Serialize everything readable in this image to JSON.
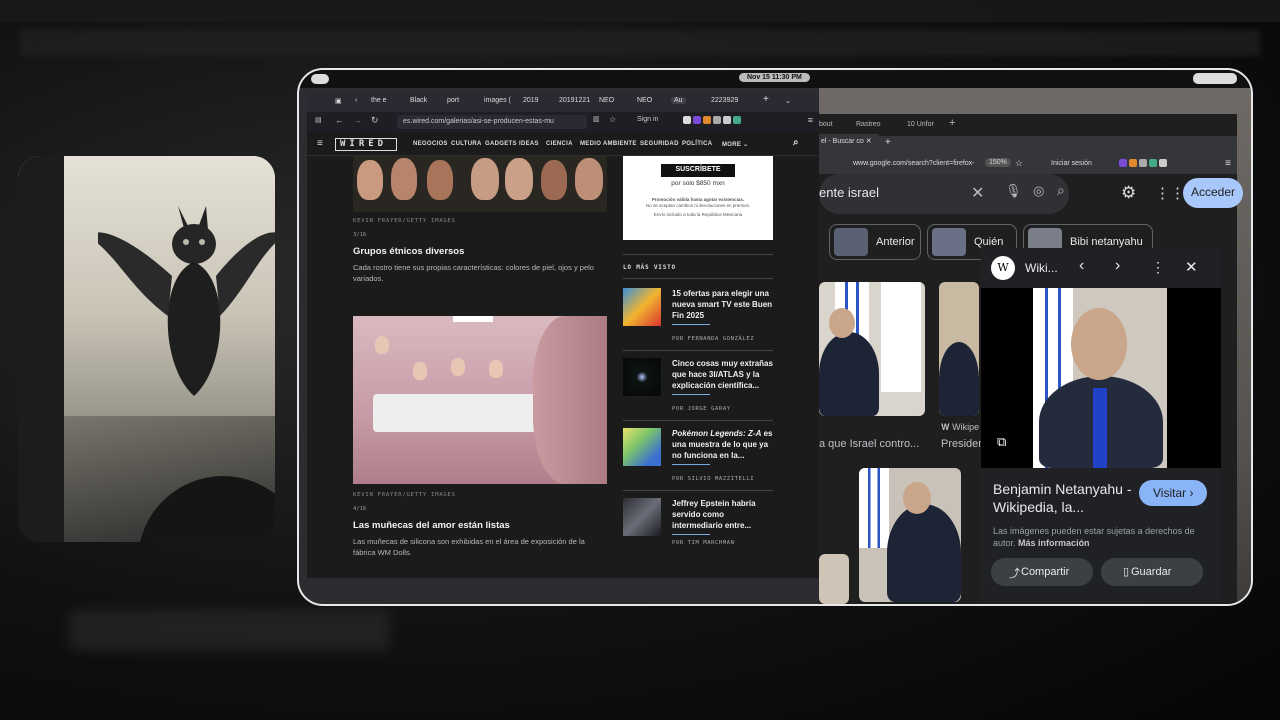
{
  "system": {
    "clock": "Nov 15  11:30 PM"
  },
  "wired_browser": {
    "tabs": [
      "the e",
      "Black",
      "port",
      "images (",
      "2019",
      "20191221",
      "NEO",
      "NEO",
      "Au",
      "2223929"
    ],
    "url": "es.wired.com/galerias/asi-se-producen-estas-mu",
    "sign_in": "Sign in",
    "logo": "WIRED",
    "nav": [
      "NEGOCIOS",
      "CULTURA",
      "GADGETS",
      "IDEAS",
      "CIENCIA",
      "MEDIO AMBIENTE",
      "SEGURIDAD",
      "POLÍTICA",
      "MORE"
    ],
    "slides": [
      {
        "credit": "KEVIN FRAYER/GETTY IMAGES",
        "count": "3/16",
        "title": "Grupos étnicos diversos",
        "desc": "Cada rostro tiene sus propias características: colores de piel, ojos y pelo variados."
      },
      {
        "credit": "KEVIN FRAYER/GETTY IMAGES",
        "count": "4/16",
        "title": "Las muñecas del amor están listas",
        "desc": "Las muñecas de silicona son exhibidas en el área de exposición de la fábrica WM Dolls."
      }
    ],
    "ad": {
      "button": "SUSCRÍBETE",
      "price": "por solo $850 mxn",
      "note1": "Promoción válida hasta agotar existencias.",
      "note2": "No se aceptan cambios ni devoluciones en premios.",
      "note3": "Envío incluido a toda la República Mexicana"
    },
    "most_viewed_title": "LO MÁS VISTO",
    "most_viewed": [
      {
        "title": "15 ofertas para elegir una nueva smart TV este Buen Fin 2025",
        "author": "POR FERNANDA GONZÁLEZ"
      },
      {
        "title": "Cinco cosas muy extrañas que hace 3I/ATLAS y la explicación científica...",
        "author": "POR JORGE GARAY"
      },
      {
        "title_italic": "Pokémon Legends: Z-A",
        "title": " es una muestra de lo que ya no funciona en la...",
        "author": "POR SILVIO MAZZITELLI"
      },
      {
        "title": "Jeffrey Epstein habría servido como intermediario entre...",
        "author": "POR TIM MARCHMAN"
      }
    ]
  },
  "google_browser": {
    "tabs": [
      "bout",
      "Rastreo",
      "10 Unfor"
    ],
    "active_tab": "el - Buscar co",
    "url": "www.google.com/search?client=firefox-",
    "zoom": "150%",
    "signin": "Iniciar sesión",
    "search_value": "ente israel",
    "acceder": "Acceder",
    "chips": [
      "Anterior",
      "Quién",
      "Bibi netanyahu"
    ],
    "captions": [
      "a que Israel contro...",
      "Wikipe",
      "Presidente"
    ],
    "wiki": {
      "source": "Wiki...",
      "title": "Benjamin Netanyahu - Wikipedia, la...",
      "visit": "Visitar",
      "note": "Las imágenes pueden estar sujetas a derechos de autor.",
      "more": "Más información",
      "share": "Compartir",
      "save": "Guardar"
    }
  }
}
